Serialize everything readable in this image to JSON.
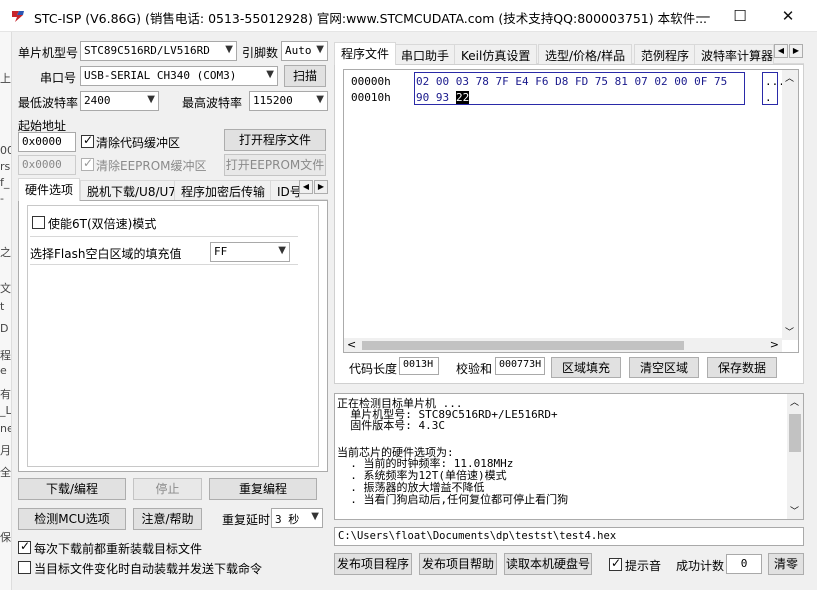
{
  "window": {
    "title": "STC-ISP (V6.86G) (销售电话: 0513-55012928) 官网:www.STCMCUDATA.com  (技术支持QQ:800003751) 本软件...",
    "min": "—",
    "max": "☐",
    "close": "✕"
  },
  "bg_strip": [
    "上",
    "00",
    "rs",
    "f_",
    "-",
    "之",
    "文",
    "t",
    "D",
    "程",
    "e",
    "有",
    "_L",
    "ne",
    "月",
    "全",
    "保"
  ],
  "left": {
    "mcu_label": "单片机型号",
    "mcu_value": "STC89C516RD/LV516RD",
    "pins_label": "引脚数",
    "pins_value": "Auto",
    "port_label": "串口号",
    "port_value": "USB-SERIAL CH340 (COM3)",
    "scan_button": "扫描",
    "min_baud_label": "最低波特率",
    "min_baud_value": "2400",
    "max_baud_label": "最高波特率",
    "max_baud_value": "115200",
    "start_addr_label": "起始地址",
    "code_addr": "0x0000",
    "clear_code_label": "清除代码缓冲区",
    "open_prog_button": "打开程序文件",
    "eeprom_addr": "0x0000",
    "clear_eeprom_label": "清除EEPROM缓冲区",
    "open_eeprom_button": "打开EEPROM文件",
    "tabs": [
      "硬件选项",
      "脱机下载/U8/U7",
      "程序加密后传输",
      "ID号"
    ],
    "option_6t_label": "使能6T(双倍速)模式",
    "fill_label": "选择Flash空白区域的填充值",
    "fill_value": "FF",
    "download_button": "下载/编程",
    "stop_button": "停止",
    "reprogram_button": "重复编程",
    "detect_button": "检测MCU选项",
    "help_button": "注意/帮助",
    "delay_label": "重复延时",
    "delay_value": "3 秒",
    "reload_label": "每次下载前都重新装载目标文件",
    "auto_label": "当目标文件变化时自动装载并发送下载命令"
  },
  "right": {
    "tabs": [
      "程序文件",
      "串口助手",
      "Keil仿真设置",
      "选型/价格/样品",
      "范例程序",
      "波特率计算器"
    ],
    "hex_rows": [
      {
        "addr": "00000h",
        "bytes": "02 00 03 78 7F E4 F6 D8 FD 75 81 07 02 00 0F 75",
        "ascii": "..."
      },
      {
        "addr": "00010h",
        "bytes": "90 93",
        "cursor": "22",
        "ascii": "."
      }
    ],
    "code_len_label": "代码长度",
    "code_len_value": "0013H",
    "checksum_label": "校验和",
    "checksum_value": "000773H",
    "fill_button": "区域填充",
    "clear_button": "清空区域",
    "save_button": "保存数据",
    "log_lines": [
      "正在检测目标单片机 ...",
      "  单片机型号: STC89C516RD+/LE516RD+",
      "  固件版本号: 4.3C",
      "",
      "当前芯片的硬件选项为:",
      "  . 当前的时钟频率: 11.018MHz",
      "  . 系统频率为12T(单倍速)模式",
      "  . 振荡器的放大增益不降低",
      "  . 当看门狗启动后,任何复位都可停止看门狗"
    ],
    "file_path": "C:\\Users\\float\\Documents\\dp\\testst\\test4.hex",
    "publish_button": "发布项目程序",
    "publish_help_button": "发布项目帮助",
    "read_disk_button": "读取本机硬盘号",
    "sound_label": "提示音",
    "success_label": "成功计数",
    "success_value": "0",
    "clear_count_button": "清零"
  }
}
